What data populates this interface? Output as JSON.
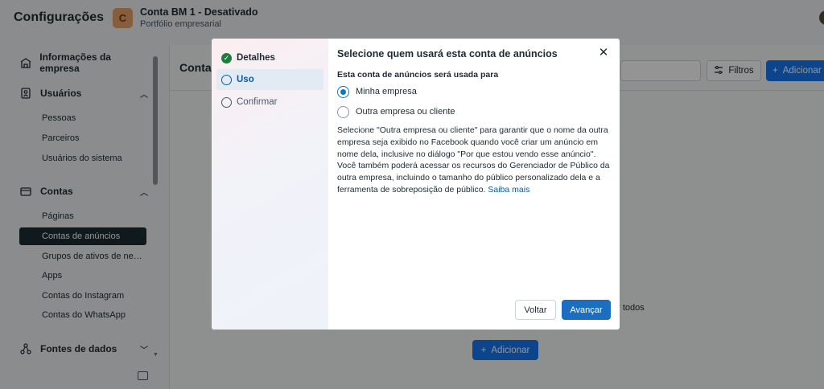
{
  "header": {
    "app_title": "Configurações",
    "account_initial": "C",
    "account_name": "Conta BM 1 - Desativado",
    "account_sub": "Portfólio empresarial"
  },
  "sidebar": {
    "sections": [
      {
        "label": "Informações da empresa",
        "icon": "building-icon"
      },
      {
        "label": "Usuários",
        "icon": "user-badge-icon"
      },
      {
        "label": "Contas",
        "icon": "folder-icon"
      },
      {
        "label": "Fontes de dados",
        "icon": "data-sources-icon"
      }
    ],
    "users_items": [
      "Pessoas",
      "Parceiros",
      "Usuários do sistema"
    ],
    "accounts_items": [
      "Páginas",
      "Contas de anúncios",
      "Grupos de ativos de negó...",
      "Apps",
      "Contas do Instagram",
      "Contas do WhatsApp"
    ],
    "active_item": "Contas de anúncios"
  },
  "main": {
    "heading": "Conta",
    "filters_label": "Filtros",
    "add_label": "Adicionar",
    "empty_fragment": "ar todos",
    "add_center_label": "Adicionar"
  },
  "modal": {
    "steps": [
      {
        "label": "Detalhes",
        "state": "done"
      },
      {
        "label": "Uso",
        "state": "current"
      },
      {
        "label": "Confirmar",
        "state": "pending"
      }
    ],
    "title": "Selecione quem usará esta conta de anúncios",
    "section_label": "Esta conta de anúncios será usada para",
    "options": [
      {
        "label": "Minha empresa",
        "selected": true
      },
      {
        "label": "Outra empresa ou cliente",
        "selected": false
      }
    ],
    "description": "Selecione \"Outra empresa ou cliente\" para garantir que o nome da outra empresa seja exibido no Facebook quando você criar um anúncio em nome dela, inclusive no diálogo \"Por que estou vendo esse anúncio\". Você também poderá acessar os recursos do Gerenciador de Público da outra empresa, incluindo o tamanho do público personalizado dela e a ferramenta de sobreposição de público.",
    "learn_more": "Saiba mais",
    "back_label": "Voltar",
    "next_label": "Avançar"
  },
  "colors": {
    "primary": "#1877f2",
    "active_sidebar": "#1c2b33",
    "step_done": "#1c7c3b",
    "link": "#0a5ba8"
  }
}
